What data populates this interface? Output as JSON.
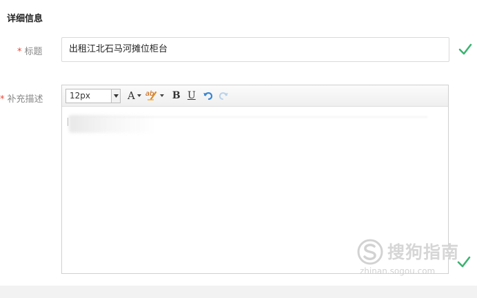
{
  "section": {
    "title": "详细信息"
  },
  "title_field": {
    "required_mark": "*",
    "label": "标题",
    "value": "出租江北石马河摊位柜台"
  },
  "description_field": {
    "required_mark": "*",
    "label": "补充描述"
  },
  "toolbar": {
    "font_size": "12px",
    "font_color_label": "A",
    "highlight_label": "ab",
    "bold_label": "B",
    "underline_label": "U"
  },
  "watermark": {
    "text": "搜狗指南",
    "url": "zhinan.sogou.com"
  },
  "colors": {
    "check": "#3cb371",
    "required": "#e43",
    "label": "#888888",
    "undo": "#3a86d4"
  },
  "icons": [
    "check-icon",
    "dropdown-caret-icon",
    "font-color-icon",
    "highlight-icon",
    "bold-icon",
    "underline-icon",
    "undo-icon",
    "redo-icon",
    "sogou-logo-icon"
  ]
}
